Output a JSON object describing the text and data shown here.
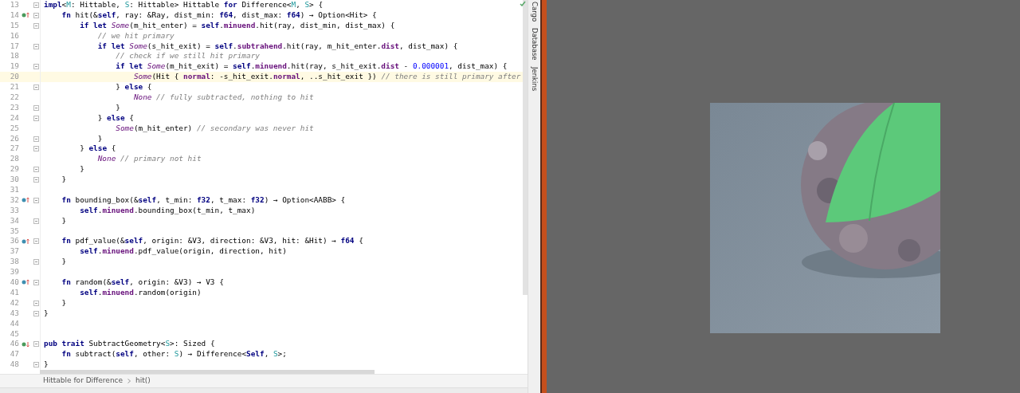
{
  "editor": {
    "lines": [
      {
        "number": "13",
        "fold": true,
        "tokens": [
          {
            "kw": "impl"
          },
          {
            "p": "<"
          },
          {
            "tp": "M"
          },
          {
            "p": ": Hittable, "
          },
          {
            "tp": "S"
          },
          {
            "p": ": Hittable> Hittable "
          },
          {
            "kw": "for"
          },
          {
            "p": " Difference<"
          },
          {
            "tp": "M"
          },
          {
            "p": ", "
          },
          {
            "tp": "S"
          },
          {
            "p": "> {"
          }
        ]
      },
      {
        "number": "14",
        "fold": true,
        "marker": {
          "kind": "up",
          "color": "#4b9a5c"
        },
        "tokens": [
          {
            "kw": "    fn"
          },
          {
            "p": " hit(&"
          },
          {
            "kw": "self"
          },
          {
            "p": ", ray: &Ray, dist_min: "
          },
          {
            "kw": "f64"
          },
          {
            "p": ", dist_max: "
          },
          {
            "kw": "f64"
          },
          {
            "p": ") → Option<Hit> {"
          }
        ]
      },
      {
        "number": "15",
        "fold": true,
        "tokens": [
          {
            "kw": "        if let "
          },
          {
            "en": "Some"
          },
          {
            "p": "(m_hit_enter) = "
          },
          {
            "kw": "self"
          },
          {
            "p": "."
          },
          {
            "fd": "minuend"
          },
          {
            "p": ".hit(ray, dist_min, dist_max) {"
          }
        ]
      },
      {
        "number": "16",
        "tokens": [
          {
            "cm": "            // we hit primary"
          }
        ]
      },
      {
        "number": "17",
        "fold": true,
        "tokens": [
          {
            "kw": "            if let "
          },
          {
            "en": "Some"
          },
          {
            "p": "(s_hit_exit) = "
          },
          {
            "kw": "self"
          },
          {
            "p": "."
          },
          {
            "fd": "subtrahend"
          },
          {
            "p": ".hit(ray, m_hit_enter."
          },
          {
            "fd": "dist"
          },
          {
            "p": ", dist_max) {"
          }
        ]
      },
      {
        "number": "18",
        "tokens": [
          {
            "cm": "                // check if we still hit primary"
          }
        ]
      },
      {
        "number": "19",
        "fold": true,
        "tokens": [
          {
            "kw": "                if let "
          },
          {
            "en": "Some"
          },
          {
            "p": "(m_hit_exit) = "
          },
          {
            "kw": "self"
          },
          {
            "p": "."
          },
          {
            "fd": "minuend"
          },
          {
            "p": ".hit(ray, s_hit_exit."
          },
          {
            "fd": "dist"
          },
          {
            "p": " - "
          },
          {
            "num": "0.000001"
          },
          {
            "p": ", dist_max) {"
          }
        ]
      },
      {
        "number": "20",
        "current": true,
        "tokens": [
          {
            "en": "                    Some"
          },
          {
            "p": "(Hit { "
          },
          {
            "fd": "normal"
          },
          {
            "p": ": -s_hit_exit."
          },
          {
            "fd": "normal"
          },
          {
            "p": ", ..s_hit_exit }) "
          },
          {
            "cm": "// there is still primary after"
          }
        ]
      },
      {
        "number": "21",
        "fold": true,
        "tokens": [
          {
            "p": "                } "
          },
          {
            "kw": "else"
          },
          {
            "p": " {"
          }
        ]
      },
      {
        "number": "22",
        "tokens": [
          {
            "en": "                    None"
          },
          {
            "cm": " // fully subtracted, nothing to hit"
          }
        ]
      },
      {
        "number": "23",
        "fold": true,
        "tokens": [
          {
            "p": "                }"
          }
        ]
      },
      {
        "number": "24",
        "fold": true,
        "tokens": [
          {
            "p": "            } "
          },
          {
            "kw": "else"
          },
          {
            "p": " {"
          }
        ]
      },
      {
        "number": "25",
        "tokens": [
          {
            "en": "                Some"
          },
          {
            "p": "(m_hit_enter) "
          },
          {
            "cm": "// secondary was never hit"
          }
        ]
      },
      {
        "number": "26",
        "fold": true,
        "tokens": [
          {
            "p": "            }"
          }
        ]
      },
      {
        "number": "27",
        "fold": true,
        "tokens": [
          {
            "p": "        } "
          },
          {
            "kw": "else"
          },
          {
            "p": " {"
          }
        ]
      },
      {
        "number": "28",
        "tokens": [
          {
            "en": "            None"
          },
          {
            "cm": " // primary not hit"
          }
        ]
      },
      {
        "number": "29",
        "fold": true,
        "tokens": [
          {
            "p": "        }"
          }
        ]
      },
      {
        "number": "30",
        "fold": true,
        "tokens": [
          {
            "p": "    }"
          }
        ]
      },
      {
        "number": "31"
      },
      {
        "number": "32",
        "fold": true,
        "marker": {
          "kind": "up",
          "color": "#3f8fb0"
        },
        "tokens": [
          {
            "kw": "    fn"
          },
          {
            "p": " bounding_box(&"
          },
          {
            "kw": "self"
          },
          {
            "p": ", t_min: "
          },
          {
            "kw": "f32"
          },
          {
            "p": ", t_max: "
          },
          {
            "kw": "f32"
          },
          {
            "p": ") → Option<AABB> {"
          }
        ]
      },
      {
        "number": "33",
        "tokens": [
          {
            "kw": "        self"
          },
          {
            "p": "."
          },
          {
            "fd": "minuend"
          },
          {
            "p": ".bounding_box(t_min, t_max)"
          }
        ]
      },
      {
        "number": "34",
        "fold": true,
        "tokens": [
          {
            "p": "    }"
          }
        ]
      },
      {
        "number": "35"
      },
      {
        "number": "36",
        "fold": true,
        "marker": {
          "kind": "up",
          "color": "#3f8fb0"
        },
        "tokens": [
          {
            "kw": "    fn"
          },
          {
            "p": " pdf_value(&"
          },
          {
            "kw": "self"
          },
          {
            "p": ", origin: &V3, direction: &V3, hit: &Hit) → "
          },
          {
            "kw": "f64"
          },
          {
            "p": " {"
          }
        ]
      },
      {
        "number": "37",
        "tokens": [
          {
            "kw": "        self"
          },
          {
            "p": "."
          },
          {
            "fd": "minuend"
          },
          {
            "p": ".pdf_value(origin, direction, hit)"
          }
        ]
      },
      {
        "number": "38",
        "fold": true,
        "tokens": [
          {
            "p": "    }"
          }
        ]
      },
      {
        "number": "39"
      },
      {
        "number": "40",
        "fold": true,
        "marker": {
          "kind": "up",
          "color": "#3f8fb0"
        },
        "tokens": [
          {
            "kw": "    fn"
          },
          {
            "p": " random(&"
          },
          {
            "kw": "self"
          },
          {
            "p": ", origin: &V3) → V3 {"
          }
        ]
      },
      {
        "number": "41",
        "tokens": [
          {
            "kw": "        self"
          },
          {
            "p": "."
          },
          {
            "fd": "minuend"
          },
          {
            "p": ".random(origin)"
          }
        ]
      },
      {
        "number": "42",
        "fold": true,
        "tokens": [
          {
            "p": "    }"
          }
        ]
      },
      {
        "number": "43",
        "fold": true,
        "tokens": [
          {
            "p": "}"
          }
        ]
      },
      {
        "number": "44"
      },
      {
        "number": "45"
      },
      {
        "number": "46",
        "fold": true,
        "marker": {
          "kind": "down",
          "color": "#4b9a5c"
        },
        "tokens": [
          {
            "kw": "pub trait"
          },
          {
            "p": " SubtractGeometry<"
          },
          {
            "tp": "S"
          },
          {
            "p": ">: Sized {"
          }
        ]
      },
      {
        "number": "47",
        "tokens": [
          {
            "kw": "    fn"
          },
          {
            "p": " subtract("
          },
          {
            "kw": "self"
          },
          {
            "p": ", other: "
          },
          {
            "tp": "S"
          },
          {
            "p": ") → Difference<"
          },
          {
            "kw": "Self"
          },
          {
            "p": ", "
          },
          {
            "tp": "S"
          },
          {
            "p": ">;"
          }
        ]
      },
      {
        "number": "48",
        "fold": true,
        "tokens": [
          {
            "p": "}"
          }
        ]
      }
    ]
  },
  "breadcrumbs": [
    "Hittable for Difference",
    "hit()"
  ],
  "tool_windows": [
    "Cargo",
    "Database",
    "Jenkins"
  ]
}
